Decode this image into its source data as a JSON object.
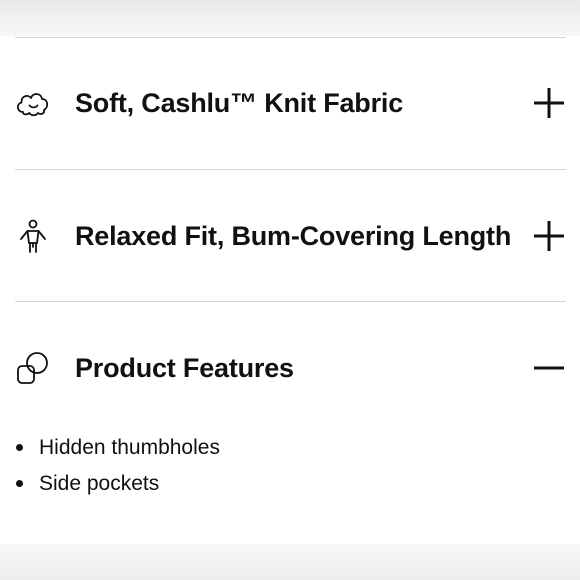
{
  "accordion": {
    "items": [
      {
        "title": "Soft, Cashlu™ Knit Fabric",
        "icon": "cloud-icon",
        "toggle": "plus-icon",
        "expanded": false
      },
      {
        "title": "Relaxed Fit, Bum-Covering Length",
        "icon": "person-icon",
        "toggle": "plus-icon",
        "expanded": false
      },
      {
        "title": "Product Features",
        "icon": "overlapping-shapes-icon",
        "toggle": "minus-icon",
        "expanded": true
      }
    ]
  },
  "features": {
    "items": [
      "Hidden thumbholes",
      "Side pockets"
    ]
  },
  "colors": {
    "text": "#111111",
    "divider": "#d6d6d6",
    "background": "#ffffff"
  }
}
